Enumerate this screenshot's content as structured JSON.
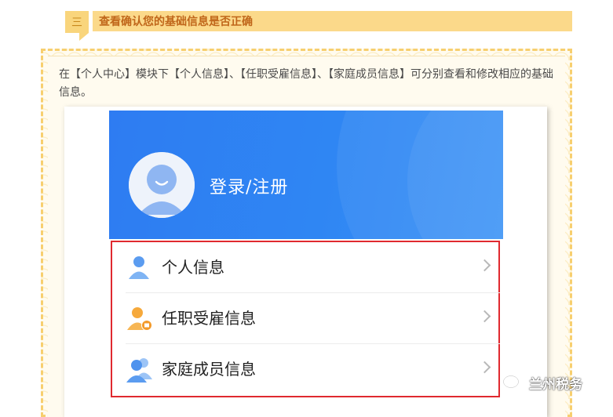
{
  "section": {
    "number": "三",
    "title": "查看确认您的基础信息是否正确"
  },
  "intro_text": "在【个人中心】模块下【个人信息】、【任职受雇信息】、【家庭成员信息】可分别查看和修改相应的基础信息。",
  "profile": {
    "login_label": "登录/注册",
    "header_color": "#2e7cf2"
  },
  "menu": {
    "highlight_color": "#e0292f",
    "items": [
      {
        "label": "个人信息",
        "icon": "person-icon"
      },
      {
        "label": "任职受雇信息",
        "icon": "employment-icon"
      },
      {
        "label": "家庭成员信息",
        "icon": "family-icon"
      }
    ]
  },
  "watermark": {
    "label": "兰州税务",
    "icon": "wechat-icon"
  }
}
